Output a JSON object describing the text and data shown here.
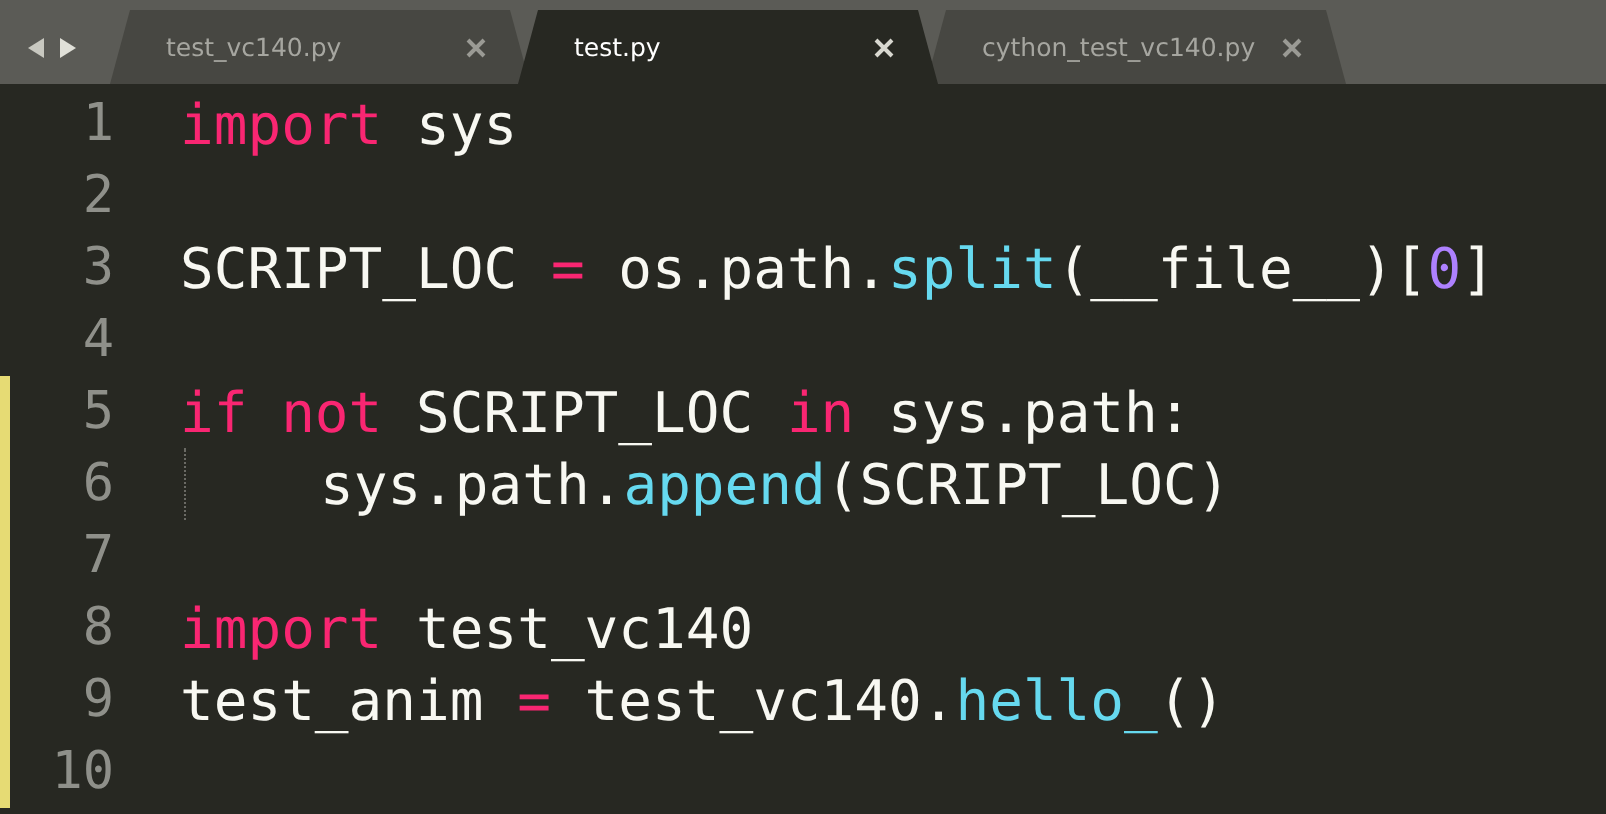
{
  "tabs": [
    {
      "label": "test_vc140.py",
      "selected": false
    },
    {
      "label": "test.py",
      "selected": true
    },
    {
      "label": "cython_test_vc140.py",
      "selected": false
    }
  ],
  "lines": [
    {
      "number": "1",
      "modified": false,
      "tokens": [
        {
          "kind": "keyword",
          "text": "import"
        },
        {
          "kind": "plain",
          "text": " sys"
        }
      ]
    },
    {
      "number": "2",
      "modified": false
    },
    {
      "number": "3",
      "modified": false,
      "tokens": [
        {
          "kind": "plain",
          "text": "SCRIPT_LOC "
        },
        {
          "kind": "keyword",
          "text": "="
        },
        {
          "kind": "plain",
          "text": " os.path."
        },
        {
          "kind": "function",
          "text": "split"
        },
        {
          "kind": "plain",
          "text": "(__file__)["
        },
        {
          "kind": "number",
          "text": "0"
        },
        {
          "kind": "plain",
          "text": "]"
        }
      ]
    },
    {
      "number": "4",
      "modified": false
    },
    {
      "number": "5",
      "modified": true,
      "tokens": [
        {
          "kind": "keyword",
          "text": "if"
        },
        {
          "kind": "keyword",
          "text": " not"
        },
        {
          "kind": "plain",
          "text": " SCRIPT_LOC "
        },
        {
          "kind": "keyword",
          "text": "in"
        },
        {
          "kind": "plain",
          "text": " sys.path:"
        }
      ]
    },
    {
      "number": "6",
      "modified": true,
      "indented": true,
      "tokens": [
        {
          "kind": "plain",
          "text": "sys.path."
        },
        {
          "kind": "function",
          "text": "append"
        },
        {
          "kind": "plain",
          "text": "(SCRIPT_LOC)"
        }
      ]
    },
    {
      "number": "7",
      "modified": true
    },
    {
      "number": "8",
      "modified": true,
      "tokens": [
        {
          "kind": "keyword",
          "text": "import"
        },
        {
          "kind": "plain",
          "text": " test_vc140"
        }
      ]
    },
    {
      "number": "9",
      "modified": true,
      "tokens": [
        {
          "kind": "plain",
          "text": "test_anim "
        },
        {
          "kind": "keyword",
          "text": "="
        },
        {
          "kind": "plain",
          "text": " test_vc140."
        },
        {
          "kind": "function",
          "text": "hello_"
        },
        {
          "kind": "plain",
          "text": "()"
        }
      ]
    },
    {
      "number": "10",
      "modified": true
    }
  ]
}
